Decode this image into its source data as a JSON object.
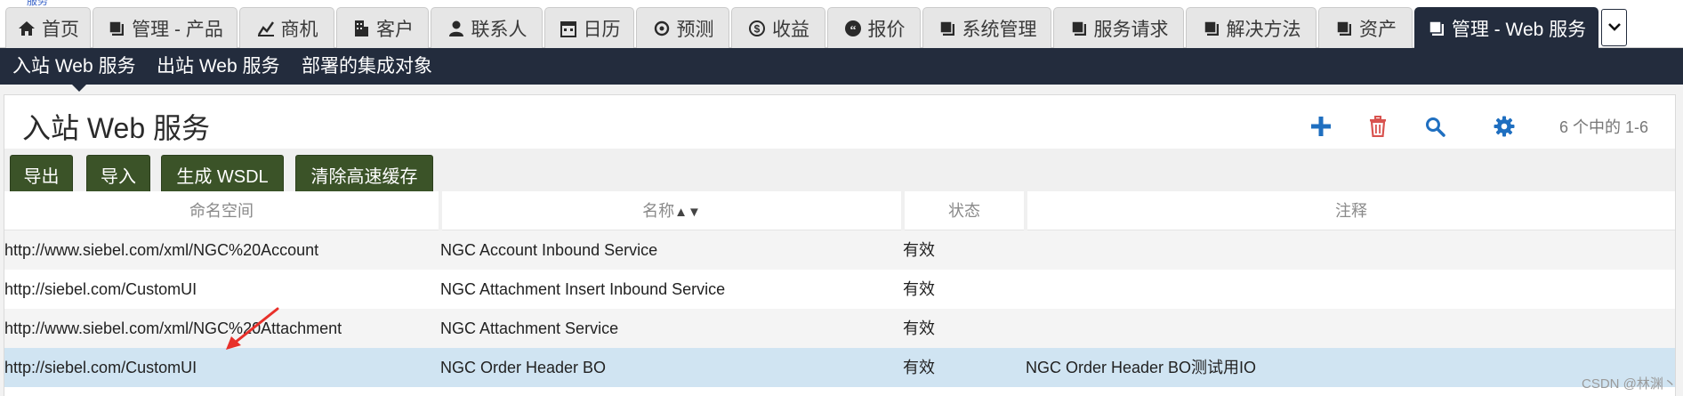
{
  "cutoff_text": "服务",
  "tabs": [
    {
      "label": "首页",
      "icon": "home-icon"
    },
    {
      "label": "管理 - 产品",
      "icon": "square-icon"
    },
    {
      "label": "商机",
      "icon": "chart-icon"
    },
    {
      "label": "客户",
      "icon": "building-icon"
    },
    {
      "label": "联系人",
      "icon": "person-icon"
    },
    {
      "label": "日历",
      "icon": "calendar-icon"
    },
    {
      "label": "预测",
      "icon": "target-icon"
    },
    {
      "label": "收益",
      "icon": "dollar-icon"
    },
    {
      "label": "报价",
      "icon": "quote-icon"
    },
    {
      "label": "系统管理",
      "icon": "square-icon"
    },
    {
      "label": "服务请求",
      "icon": "square-icon"
    },
    {
      "label": "解决方法",
      "icon": "square-icon"
    },
    {
      "label": "资产",
      "icon": "square-icon"
    },
    {
      "label": "管理 - Web 服务",
      "icon": "square-icon",
      "active": true
    }
  ],
  "subnav": {
    "items": [
      "入站 Web 服务",
      "出站 Web 服务",
      "部署的集成对象"
    ],
    "active_index": 0
  },
  "applet": {
    "title": "入站 Web 服务",
    "record_count": "6 个中的 1-6",
    "toolbar_icons": [
      "plus-icon",
      "trash-icon",
      "search-icon",
      "gear-icon"
    ],
    "buttons": [
      "导出",
      "导入",
      "生成 WSDL",
      "清除高速缓存"
    ]
  },
  "grid": {
    "columns": [
      "命名空间",
      "名称",
      "状态",
      "注释"
    ],
    "sort_indicator": "▲▼",
    "rows": [
      {
        "namespace": "http://www.siebel.com/xml/NGC%20Account",
        "name": "NGC Account Inbound Service",
        "status": "有效",
        "comment": ""
      },
      {
        "namespace": "http://siebel.com/CustomUI",
        "name": "NGC Attachment Insert Inbound Service",
        "status": "有效",
        "comment": ""
      },
      {
        "namespace": "http://www.siebel.com/xml/NGC%20Attachment",
        "name": "NGC Attachment Service",
        "status": "有效",
        "comment": ""
      },
      {
        "namespace": "http://siebel.com/CustomUI",
        "name": "NGC Order Header BO",
        "status": "有效",
        "comment": "NGC Order Header BO测试用IO",
        "selected": true
      }
    ]
  },
  "watermark": "CSDN @林渊丶",
  "colors": {
    "nav_dark": "#232c3d",
    "button_green": "#3b5328",
    "plus_blue": "#1f6fc0",
    "trash_red": "#d9534f",
    "selected_row": "#d0e4f2",
    "annotation_arrow": "#e8302a"
  }
}
